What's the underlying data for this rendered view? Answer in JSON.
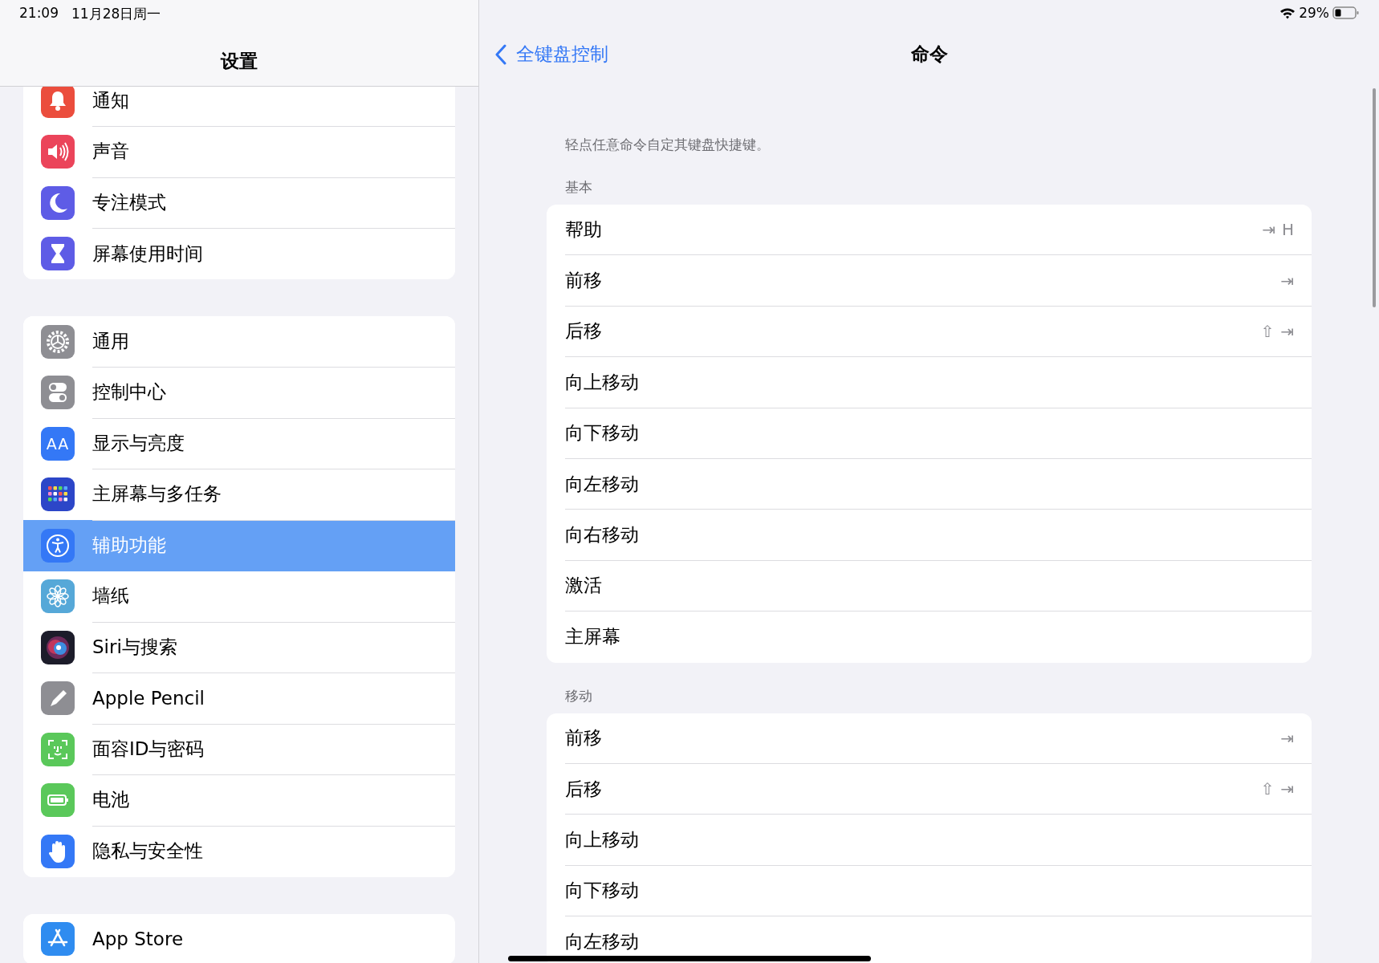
{
  "status_bar": {
    "time": "21:09",
    "date": "11月28日周一",
    "battery": "29%"
  },
  "sidebar": {
    "title": "设置",
    "groups": [
      {
        "items": [
          {
            "label": "通知",
            "selected": false
          },
          {
            "label": "声音",
            "selected": false
          },
          {
            "label": "专注模式",
            "selected": false
          },
          {
            "label": "屏幕使用时间",
            "selected": false
          }
        ]
      },
      {
        "items": [
          {
            "label": "通用",
            "selected": false
          },
          {
            "label": "控制中心",
            "selected": false
          },
          {
            "label": "显示与亮度",
            "selected": false,
            "icon_text": "AA"
          },
          {
            "label": "主屏幕与多任务",
            "selected": false
          },
          {
            "label": "辅助功能",
            "selected": true
          },
          {
            "label": "墙纸",
            "selected": false
          },
          {
            "label": "Siri与搜索",
            "selected": false
          },
          {
            "label": "Apple Pencil",
            "selected": false
          },
          {
            "label": "面容ID与密码",
            "selected": false
          },
          {
            "label": "电池",
            "selected": false
          },
          {
            "label": "隐私与安全性",
            "selected": false
          }
        ]
      },
      {
        "items": [
          {
            "label": "App Store",
            "selected": false
          }
        ]
      }
    ]
  },
  "detail": {
    "back": "全键盘控制",
    "title": "命令",
    "description": "轻点任意命令自定其键盘快捷键。",
    "sections": [
      {
        "header": "基本",
        "rows": [
          {
            "label": "帮助",
            "keys": [
              "⇥",
              "H"
            ]
          },
          {
            "label": "前移",
            "keys": [
              "⇥"
            ]
          },
          {
            "label": "后移",
            "keys": [
              "⇧",
              "⇥"
            ]
          },
          {
            "label": "向上移动"
          },
          {
            "label": "向下移动"
          },
          {
            "label": "向左移动"
          },
          {
            "label": "向右移动"
          },
          {
            "label": "激活"
          },
          {
            "label": "主屏幕"
          }
        ]
      },
      {
        "header": "移动",
        "rows": [
          {
            "label": "前移",
            "keys": [
              "⇥"
            ]
          },
          {
            "label": "后移",
            "keys": [
              "⇧",
              "⇥"
            ]
          },
          {
            "label": "向上移动"
          },
          {
            "label": "向下移动"
          },
          {
            "label": "向左移动"
          }
        ]
      }
    ]
  }
}
